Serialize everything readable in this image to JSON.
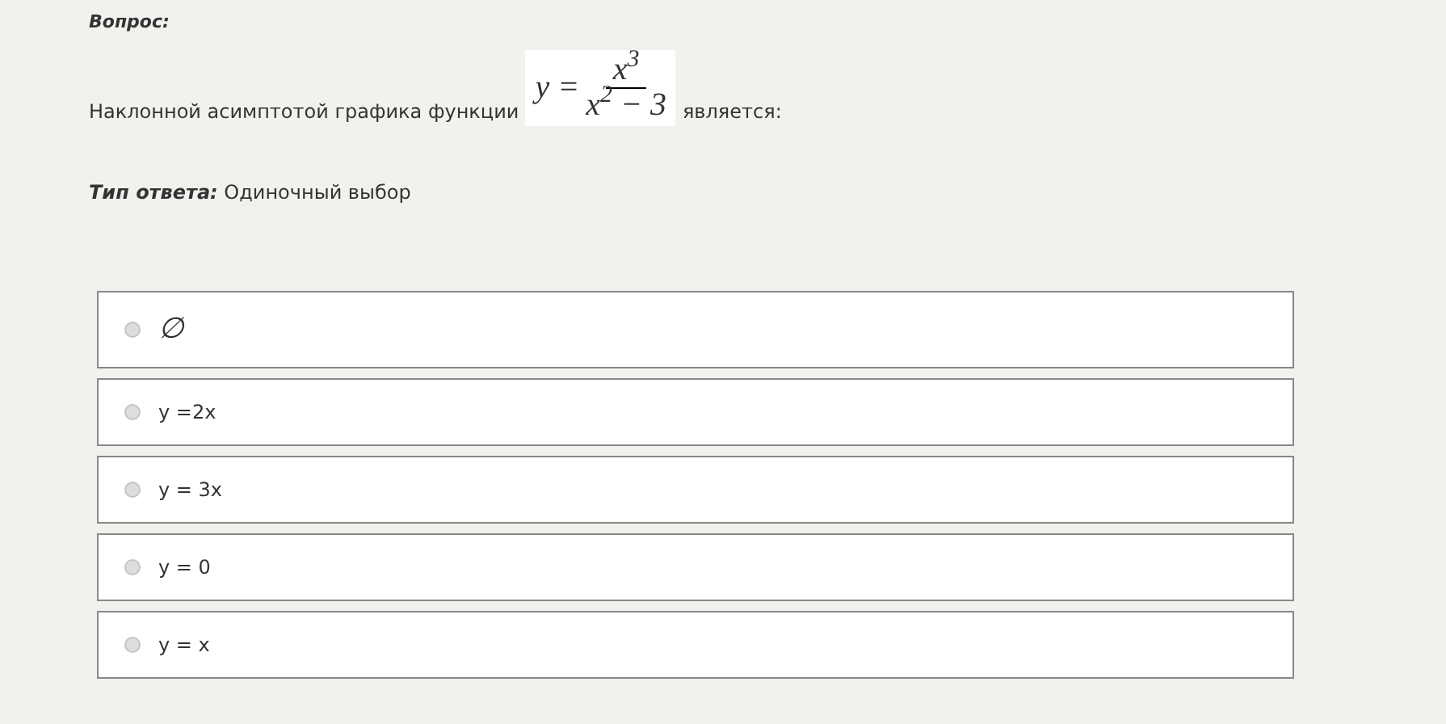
{
  "question_label": "Вопрос:",
  "question": {
    "before": "Наклонной асимптотой графика функции",
    "formula": {
      "lhs": "y =",
      "numerator": "x$^{3}$",
      "denominator": "x$^{2}$ − 3"
    },
    "after": "является:"
  },
  "answer_type": {
    "label": "Тип ответа:",
    "value": "Одиночный выбор"
  },
  "options": [
    {
      "text": "∅",
      "kind": "symbol",
      "selected": false
    },
    {
      "text": "y =2x",
      "kind": "text",
      "selected": false
    },
    {
      "text": "y = 3x",
      "kind": "text",
      "selected": false
    },
    {
      "text": "y = 0",
      "kind": "text",
      "selected": false
    },
    {
      "text": "y = x",
      "kind": "text",
      "selected": false
    }
  ]
}
